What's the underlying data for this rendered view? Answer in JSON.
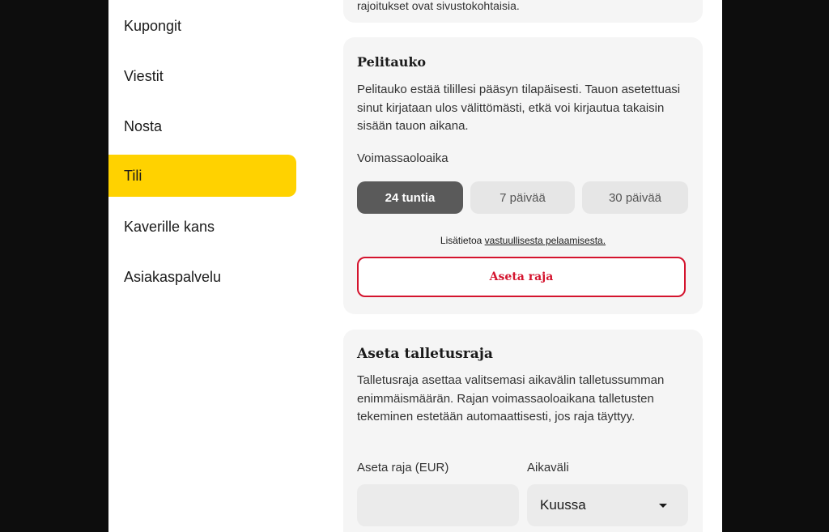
{
  "sidebar": {
    "items": [
      {
        "label": "Kupongit"
      },
      {
        "label": "Viestit"
      },
      {
        "label": "Nosta"
      },
      {
        "label": "Tili"
      },
      {
        "label": "Kaverille kans"
      },
      {
        "label": "Asiakaspalvelu"
      }
    ],
    "active": "Tili"
  },
  "top_card": {
    "partial_text": "rajoitukset ovat sivustokohtaisia."
  },
  "pelitauko": {
    "title": "Pelitauko",
    "description": "Pelitauko estää tilillesi pääsyn tilapäisesti. Tauon asetettuasi sinut kirjataan ulos välittömästi, etkä voi kirjautua takaisin sisään tauon aikana.",
    "duration_label": "Voimassaoloaika",
    "options": [
      "24 tuntia",
      "7 päivää",
      "30 päivää"
    ],
    "selected_option": "24 tuntia",
    "info_prefix": "Lisätietoa",
    "info_link": "vastuullisesta pelaamisesta.",
    "button_label": "Aseta raja"
  },
  "talletusraja": {
    "title": "Aseta talletusraja",
    "description": "Talletusraja asettaa valitsemasi aikavälin talletussumman enimmäismäärän. Rajan voimassaoloaikana talletusten tekeminen estetään automaattisesti, jos raja täyttyy.",
    "amount_label": "Aseta raja (EUR)",
    "amount_value": "",
    "period_label": "Aikaväli",
    "period_value": "Kuussa"
  },
  "colors": {
    "accent": "#ffd200",
    "danger": "#d4142e",
    "selected": "#5a5a5a",
    "background": "#0d0d0d"
  }
}
